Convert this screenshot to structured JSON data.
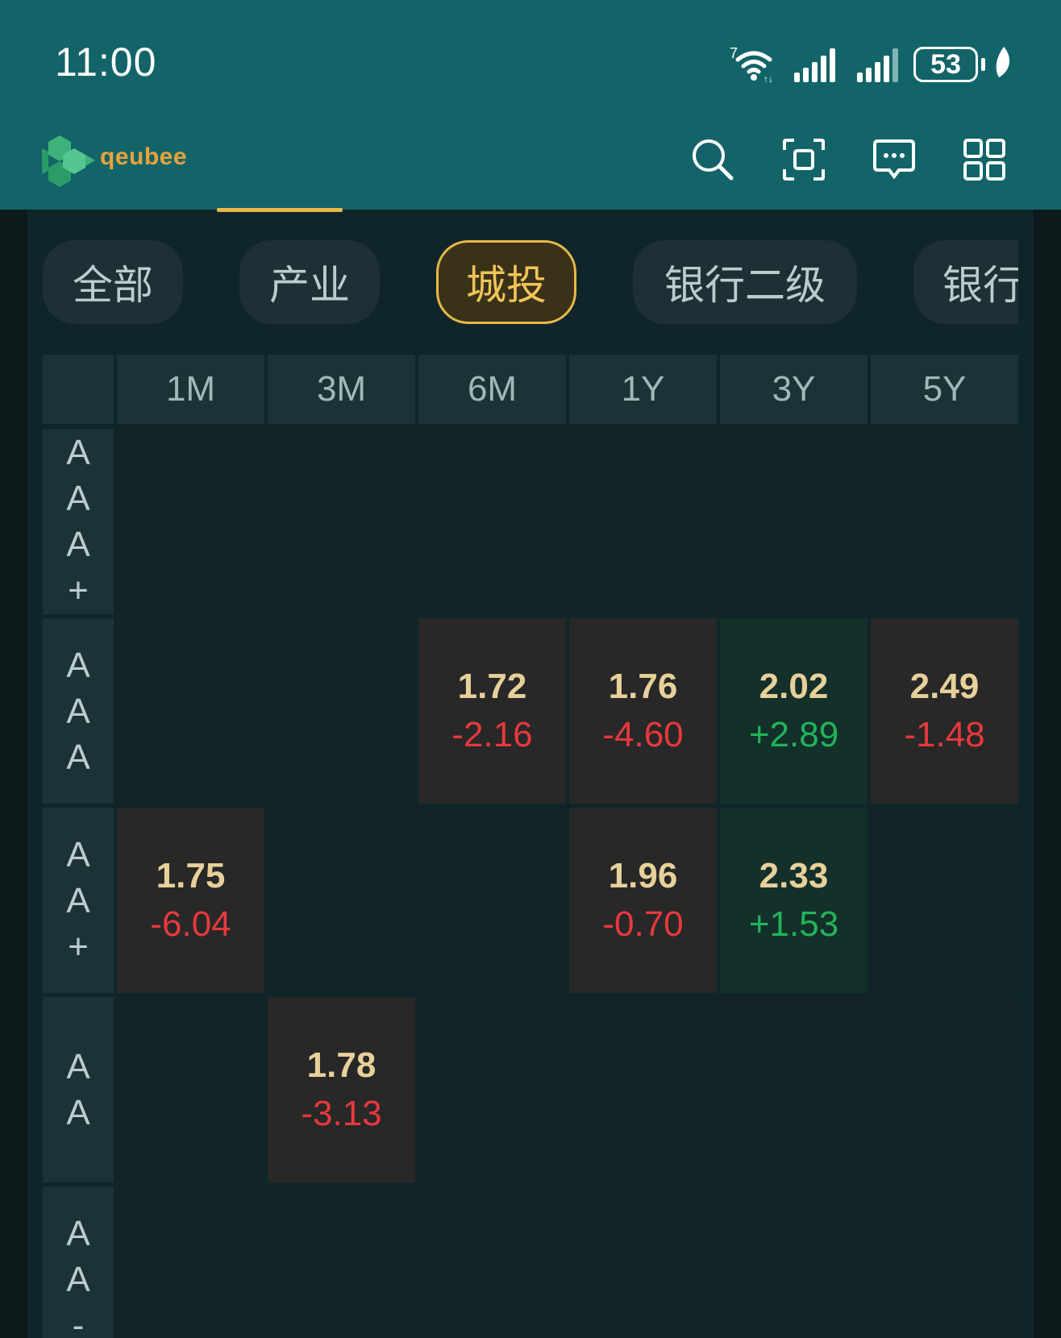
{
  "status_bar": {
    "time": "11:00",
    "network_badge": "7",
    "battery": "53"
  },
  "app_bar": {
    "logo_text": "qeubee",
    "icons": [
      "search-icon",
      "scan-icon",
      "message-icon",
      "grid-icon"
    ]
  },
  "filter_chips": [
    {
      "label": "全部",
      "active": false
    },
    {
      "label": "产业",
      "active": false
    },
    {
      "label": "城投",
      "active": true
    },
    {
      "label": "银行二级",
      "active": false
    },
    {
      "label": "银行",
      "active": false
    }
  ],
  "colors": {
    "header_bg": "#126468",
    "accent": "#e8b84a",
    "negative": "#e8383d",
    "positive": "#22b35a",
    "yield_text": "#e8d09a"
  },
  "table": {
    "columns": [
      "1M",
      "3M",
      "6M",
      "1Y",
      "3Y",
      "5Y"
    ],
    "rows": [
      {
        "rating": [
          "A",
          "A",
          "A",
          "+"
        ],
        "cells": [
          null,
          null,
          null,
          null,
          null,
          null
        ]
      },
      {
        "rating": [
          "A",
          "A",
          "A"
        ],
        "cells": [
          null,
          null,
          {
            "yield": "1.72",
            "change": "-2.16"
          },
          {
            "yield": "1.76",
            "change": "-4.60"
          },
          {
            "yield": "2.02",
            "change": "+2.89"
          },
          {
            "yield": "2.49",
            "change": "-1.48"
          }
        ]
      },
      {
        "rating": [
          "A",
          "A",
          "+"
        ],
        "cells": [
          {
            "yield": "1.75",
            "change": "-6.04"
          },
          null,
          null,
          {
            "yield": "1.96",
            "change": "-0.70"
          },
          {
            "yield": "2.33",
            "change": "+1.53"
          },
          null
        ]
      },
      {
        "rating": [
          "A",
          "A"
        ],
        "cells": [
          null,
          {
            "yield": "1.78",
            "change": "-3.13"
          },
          null,
          null,
          null,
          null
        ]
      },
      {
        "rating": [
          "A",
          "A",
          "-"
        ],
        "cells": [
          null,
          null,
          null,
          null,
          null,
          null
        ]
      }
    ]
  }
}
